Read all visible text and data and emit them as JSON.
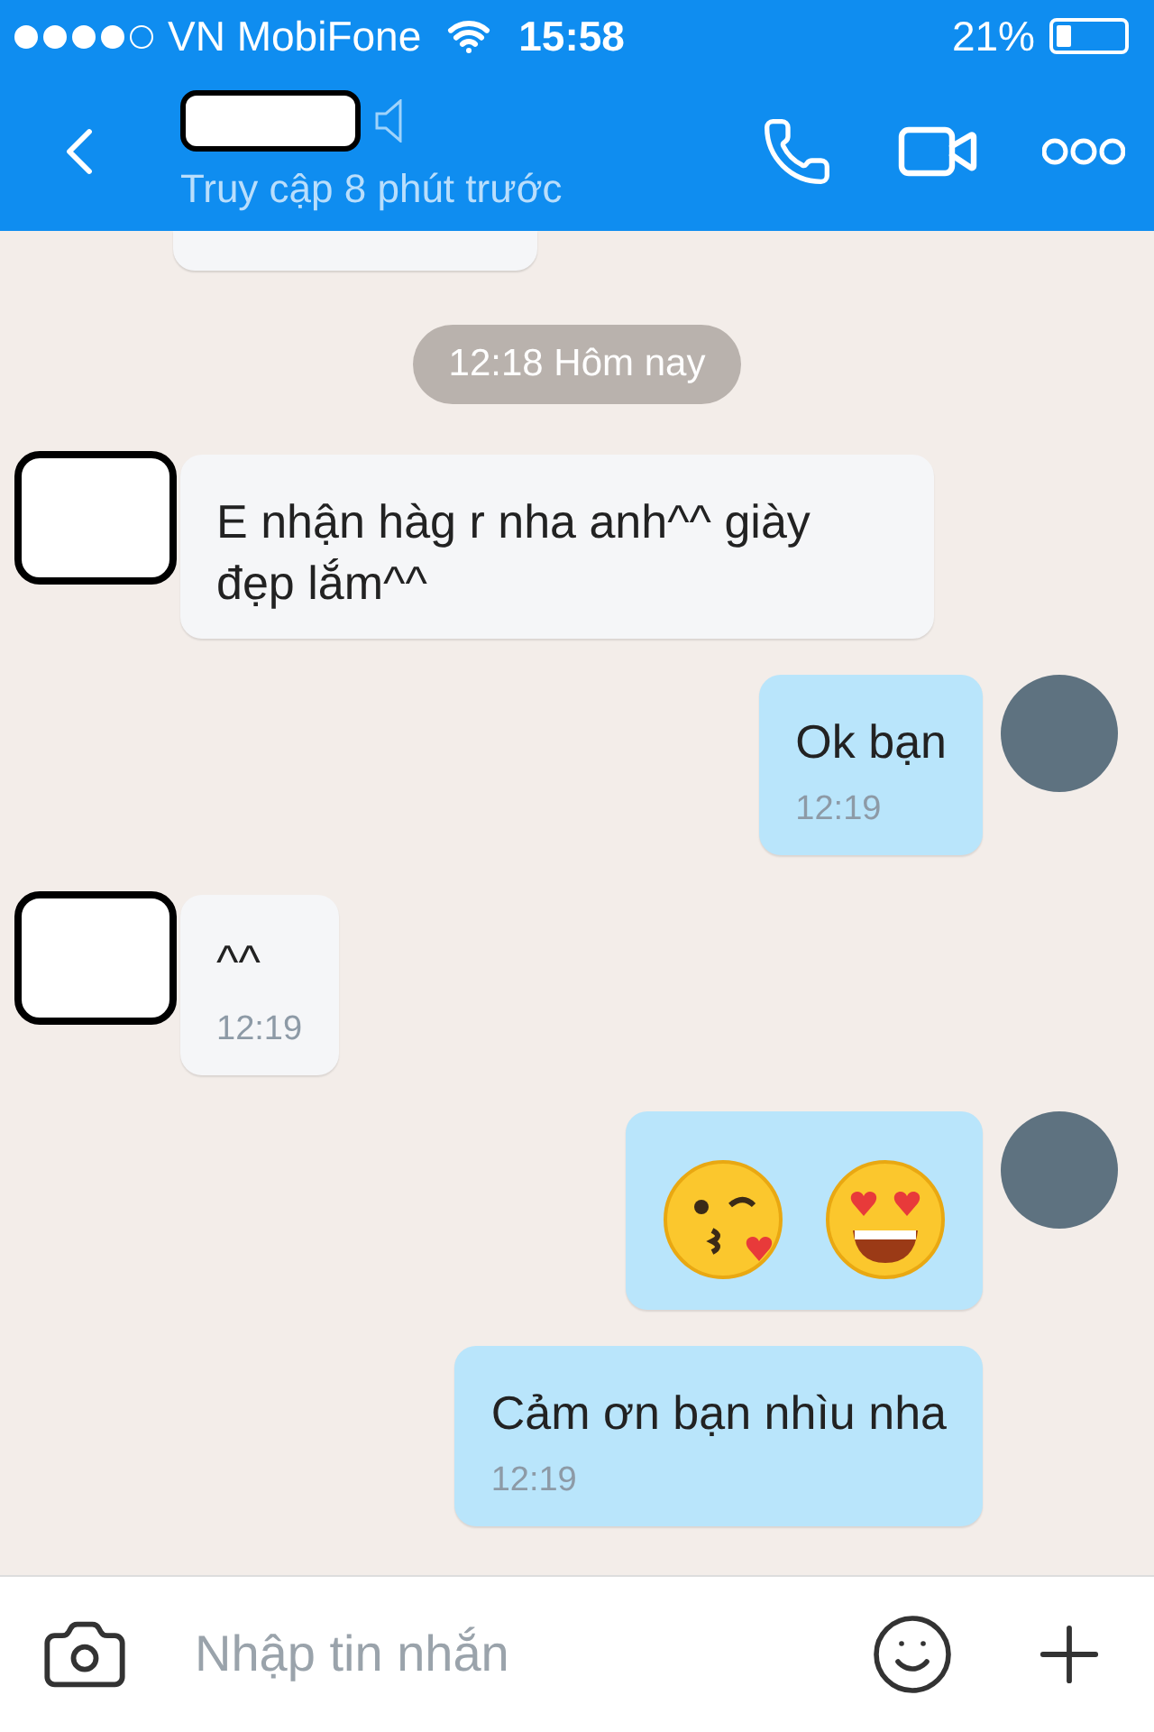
{
  "status_bar": {
    "carrier": "VN MobiFone",
    "time": "15:58",
    "battery": "21%"
  },
  "header": {
    "subtitle": "Truy cập 8 phút trước"
  },
  "date_separator": "12:18 Hôm nay",
  "messages": [
    {
      "outgoing": false,
      "kind": "text",
      "avatar": true,
      "text": "E nhận hàg r nha anh^^ giày đẹp lắm^^"
    },
    {
      "outgoing": true,
      "kind": "text",
      "avatar": true,
      "text": "Ok bạn",
      "time": "12:19"
    },
    {
      "outgoing": false,
      "kind": "text",
      "avatar": true,
      "text": "^^",
      "time": "12:19"
    },
    {
      "outgoing": true,
      "kind": "emoji",
      "avatar": true
    },
    {
      "outgoing": true,
      "kind": "text",
      "avatar": false,
      "text": "Cảm ơn bạn nhìu nha",
      "time": "12:19"
    }
  ],
  "composer": {
    "placeholder": "Nhập tin nhắn"
  }
}
